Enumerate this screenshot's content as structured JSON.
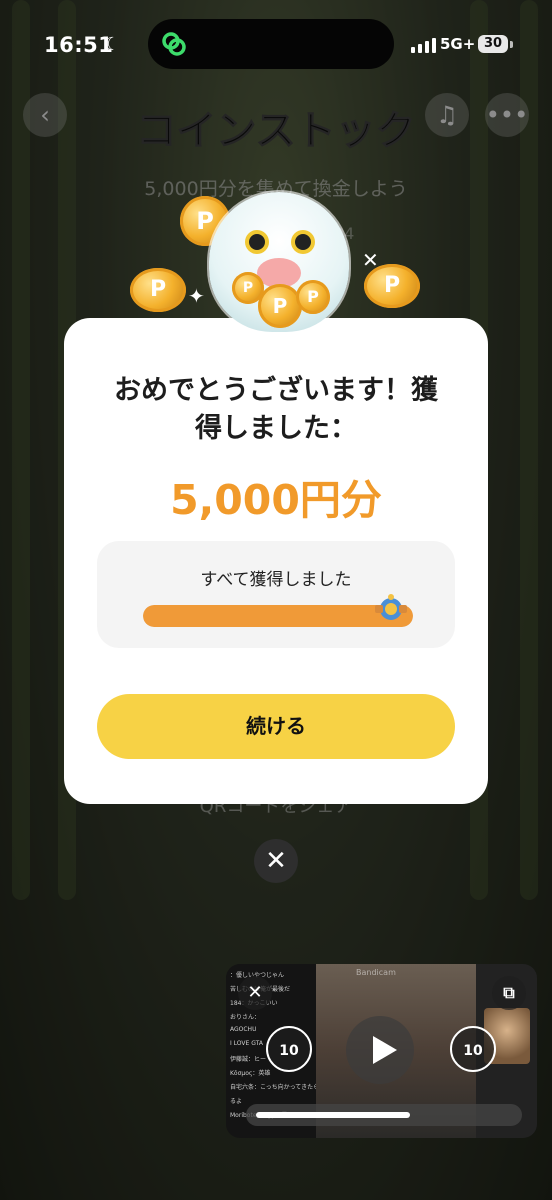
{
  "status_bar": {
    "time": "16:51",
    "network": "5G+",
    "battery": "30"
  },
  "header": {
    "title": "コインストック",
    "subtitle": "5,000円分を集めて換金しよう",
    "subnumber": "04"
  },
  "background": {
    "share_text": "QRコードをシェア"
  },
  "modal": {
    "message": "おめでとうございます！獲得しました：",
    "amount": "5,000円分",
    "progress_label": "すべて獲得しました",
    "progress_fraction": 1.0,
    "continue_label": "続ける"
  },
  "close_label": "✕",
  "pip": {
    "watermark": "Bandicam",
    "skip_back_label": "10",
    "skip_forward_label": "10",
    "playback_fraction": 0.6,
    "chat_lines": [
      "：優しいやつじゃん",
      "苦しむのは俺が最後だ",
      "184：かっこいい",
      "おりさん：",
      "AGOCHU",
      "I LOVE GTA",
      "伊藤誠：ヒー",
      "Kōσμος：英雄",
      "自宅六条：こっち向かってきたら走って逃げ",
      "るよ",
      "Moribote Elegy：優しい"
    ]
  },
  "colors": {
    "accent_orange": "#f19a2a",
    "button_yellow": "#f7d245",
    "island_logo_green": "#3ddc6b"
  }
}
